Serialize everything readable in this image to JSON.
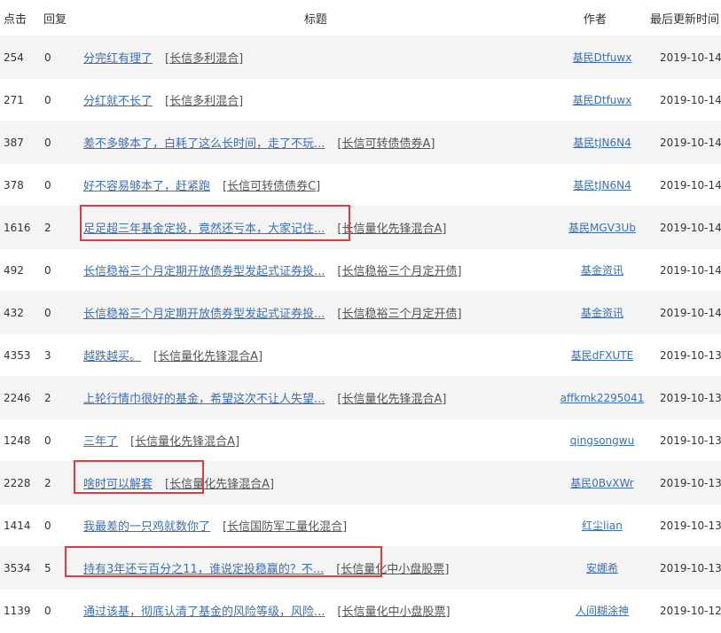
{
  "headers": {
    "clicks": "点击",
    "replies": "回复",
    "title": "标题",
    "author": "作者",
    "updated": "最后更新时间"
  },
  "rows": [
    {
      "clicks": "254",
      "replies": "0",
      "title": "分完红有理了",
      "fund": "长信多利混合",
      "author": "基民Dtfuwx",
      "updated": "2019-10-14"
    },
    {
      "clicks": "271",
      "replies": "0",
      "title": "分红就不长了",
      "fund": "长信多利混合",
      "author": "基民Dtfuwx",
      "updated": "2019-10-14"
    },
    {
      "clicks": "387",
      "replies": "0",
      "title": "差不多够本了，白耗了这么长时间，走了不玩...",
      "fund": "长信可转债债券A",
      "author": "基民tJN6N4",
      "updated": "2019-10-14"
    },
    {
      "clicks": "378",
      "replies": "0",
      "title": "好不容易够本了，赶紧跑",
      "fund": "长信可转债债券C",
      "author": "基民tJN6N4",
      "updated": "2019-10-14"
    },
    {
      "clicks": "1616",
      "replies": "2",
      "title": "足足超三年基金定投，竟然还亏本，大家记住...",
      "fund": "长信量化先锋混合A",
      "author": "基民MGV3Ub",
      "updated": "2019-10-14"
    },
    {
      "clicks": "492",
      "replies": "0",
      "title": "长信稳裕三个月定期开放债券型发起式证券投...",
      "fund": "长信稳裕三个月定开债",
      "author": "基金资讯",
      "updated": "2019-10-14"
    },
    {
      "clicks": "432",
      "replies": "0",
      "title": "长信稳裕三个月定期开放债券型发起式证券投...",
      "fund": "长信稳裕三个月定开债",
      "author": "基金资讯",
      "updated": "2019-10-14"
    },
    {
      "clicks": "4353",
      "replies": "3",
      "title": "越跌越买。",
      "fund": "长信量化先锋混合A",
      "author": "基民dFXUTE",
      "updated": "2019-10-13"
    },
    {
      "clicks": "2246",
      "replies": "2",
      "title": "上轮行情巾很好的基金，希望这次不让人失望...",
      "fund": "长信量化先锋混合A",
      "author": "affkmk2295041",
      "updated": "2019-10-13"
    },
    {
      "clicks": "1248",
      "replies": "0",
      "title": "三年了",
      "fund": "长信量化先锋混合A",
      "author": "qingsongwu",
      "updated": "2019-10-13"
    },
    {
      "clicks": "2228",
      "replies": "2",
      "title": "啥时可以解套",
      "fund": "长信量化先锋混合A",
      "author": "基民0BvXWr",
      "updated": "2019-10-13"
    },
    {
      "clicks": "1414",
      "replies": "0",
      "title": "我最差的一只鸡就数你了",
      "fund": "长信国防军工量化混合",
      "author": "红尘lian",
      "updated": "2019-10-13"
    },
    {
      "clicks": "3534",
      "replies": "5",
      "title": "持有3年还亏百分之11，谁说定投稳赢的？不...",
      "fund": "长信量化中小盘股票",
      "author": "安娜希",
      "updated": "2019-10-13"
    },
    {
      "clicks": "1139",
      "replies": "0",
      "title": "通过该基，彻底认清了基金的风险等级，风险...",
      "fund": "长信量化中小盘股票",
      "author": "人间糊涂神",
      "updated": "2019-10-12"
    }
  ],
  "colors": {
    "link": "#3b6fb6",
    "highlight": "#e23b3b",
    "row_alt": "#f4f4f4"
  }
}
